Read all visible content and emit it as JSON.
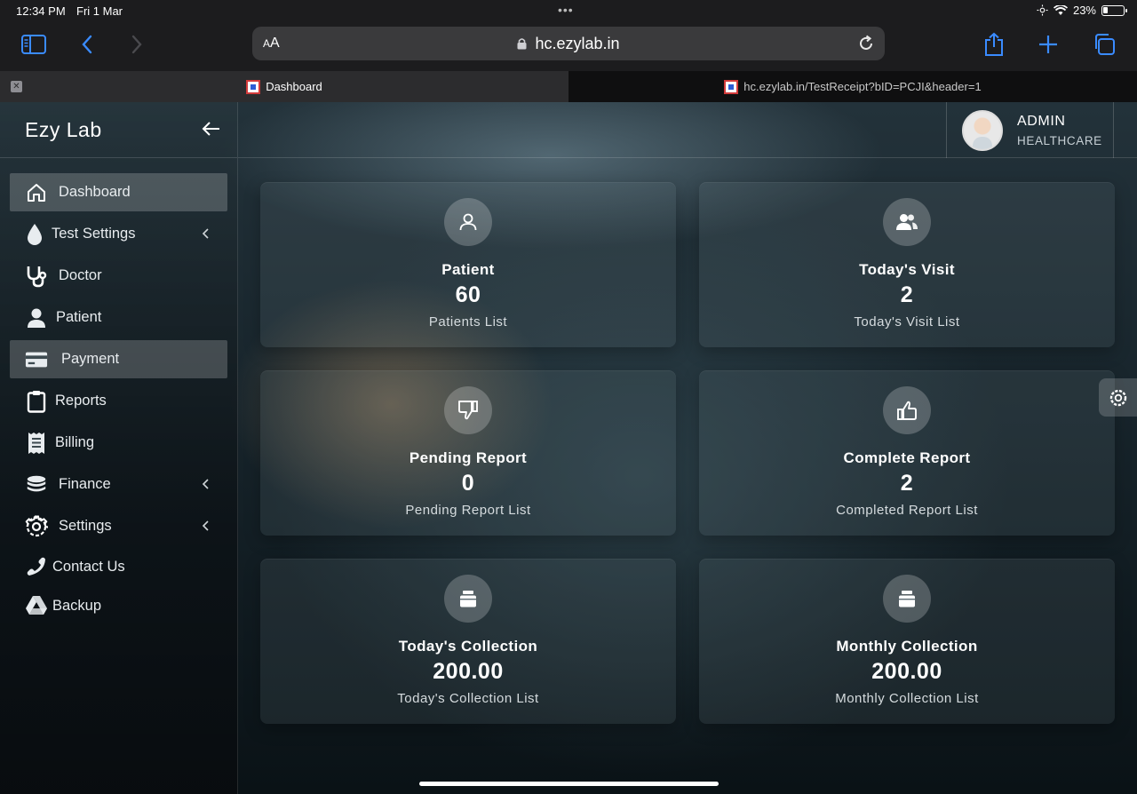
{
  "status_bar": {
    "time": "12:34 PM",
    "date": "Fri 1 Mar",
    "battery": "23%"
  },
  "browser": {
    "text_size_label": "AA",
    "url": "hc.ezylab.in",
    "tabs": [
      {
        "title": "Dashboard",
        "active": true
      },
      {
        "title": "hc.ezylab.in/TestReceipt?bID=PCJI&header=1",
        "active": false
      }
    ]
  },
  "sidebar": {
    "brand": "Ezy Lab",
    "items": [
      {
        "label": "Dashboard",
        "icon": "home-icon",
        "active": true,
        "has_submenu": false
      },
      {
        "label": "Test Settings",
        "icon": "drop-icon",
        "active": false,
        "has_submenu": true
      },
      {
        "label": "Doctor",
        "icon": "stethoscope-icon",
        "active": false,
        "has_submenu": false
      },
      {
        "label": "Patient",
        "icon": "user-icon",
        "active": false,
        "has_submenu": false
      },
      {
        "label": "Payment",
        "icon": "credit-card-icon",
        "active": true,
        "has_submenu": false
      },
      {
        "label": "Reports",
        "icon": "clipboard-icon",
        "active": false,
        "has_submenu": false
      },
      {
        "label": "Billing",
        "icon": "receipt-icon",
        "active": false,
        "has_submenu": false
      },
      {
        "label": "Finance",
        "icon": "coins-icon",
        "active": false,
        "has_submenu": true
      },
      {
        "label": "Settings",
        "icon": "gear-icon",
        "active": false,
        "has_submenu": true
      },
      {
        "label": "Contact Us",
        "icon": "phone-icon",
        "active": false,
        "has_submenu": false
      },
      {
        "label": "Backup",
        "icon": "drive-icon",
        "active": false,
        "has_submenu": false
      }
    ]
  },
  "header": {
    "user_name": "ADMIN",
    "user_role": "HEALTHCARE"
  },
  "cards": [
    {
      "title": "Patient",
      "value": "60",
      "link": "Patients List",
      "icon": "user-icon"
    },
    {
      "title": "Today's Visit",
      "value": "2",
      "link": "Today's Visit List",
      "icon": "users-icon"
    },
    {
      "title": "Pending Report",
      "value": "0",
      "link": "Pending Report List",
      "icon": "thumbs-down-icon"
    },
    {
      "title": "Complete Report",
      "value": "2",
      "link": "Completed Report List",
      "icon": "thumbs-up-icon"
    },
    {
      "title": "Today's Collection",
      "value": "200.00",
      "link": "Today's Collection List",
      "icon": "money-stack-icon"
    },
    {
      "title": "Monthly Collection",
      "value": "200.00",
      "link": "Monthly Collection List",
      "icon": "money-stack-icon"
    }
  ],
  "colors": {
    "ios_blue": "#3a8bff",
    "active_nav": "rgba(255,255,255,0.2)"
  }
}
